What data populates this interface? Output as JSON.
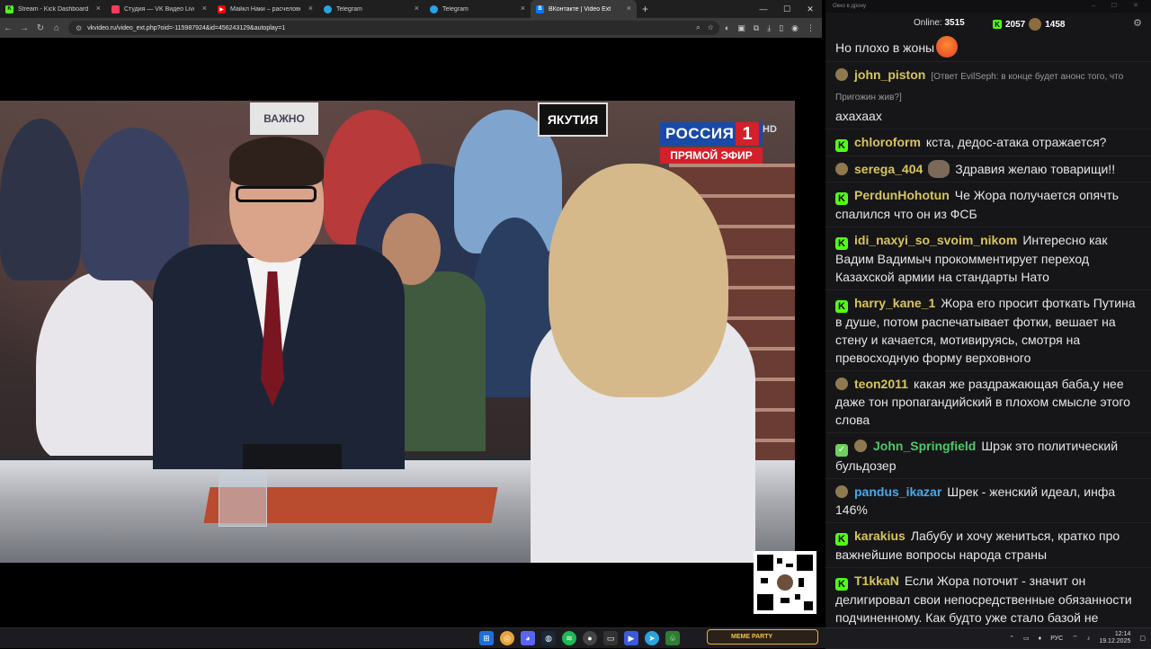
{
  "browser": {
    "tabs": [
      {
        "label": "Stream - Kick Dashboard",
        "icon": "kick-icon",
        "color": "#53fc18",
        "active": false
      },
      {
        "label": "Студия — VK Видео Live",
        "icon": "vk-video-icon",
        "color": "#ff3b5c",
        "active": false
      },
      {
        "label": "Майкл Наки – расчеловечивание",
        "icon": "youtube-icon",
        "color": "#ff0000",
        "active": false
      },
      {
        "label": "Telegram",
        "icon": "telegram-icon",
        "color": "#2aa3e0",
        "active": false
      },
      {
        "label": "Telegram",
        "icon": "telegram-icon",
        "color": "#2aa3e0",
        "active": false
      },
      {
        "label": "ВКонтакте | Video Ext",
        "icon": "vk-icon",
        "color": "#0077ff",
        "active": true
      }
    ],
    "url": "vkvideo.ru/video_ext.php?oid=-115987924&id=456243129&autoplay=1"
  },
  "video": {
    "channel_name": "РОССИЯ",
    "channel_number": "1",
    "channel_hd": "HD",
    "live_label": "ПРЯМОЙ ЭФИР",
    "sign_text": "ЯКУТИЯ",
    "sign2_text": "ВАЖНО"
  },
  "chat": {
    "window_title": "Окно в дрону",
    "online_label": "Online:",
    "online_count": "3515",
    "kick_count": "2057",
    "other_count": "1458",
    "top_message": "Но плохо в жоны",
    "messages": [
      {
        "user": "john_piston",
        "color": "#d8c55a",
        "badge": "p",
        "reply": "[Ответ EvilSeph: в конце будет анонс того, что Пригожин жив?]",
        "text": "ахахаах"
      },
      {
        "user": "chloroform",
        "color": "#d8c55a",
        "badge": "k",
        "text": "кста, дедос-атака отражается?"
      },
      {
        "user": "serega_404",
        "color": "#d8c55a",
        "badge": "p",
        "text": "Здравия желаю товарищи!!",
        "avatar": true
      },
      {
        "user": "PerdunHohotun",
        "color": "#d8c55a",
        "badge": "k",
        "text": "Че Жора получается опячть спалился что он из ФСБ"
      },
      {
        "user": "idi_naxyi_so_svoim_nikom",
        "color": "#d8c55a",
        "badge": "k",
        "text": "Интересно как Вадим Вадимыч прокомментирует переход Казахской армии на стандарты Нато"
      },
      {
        "user": "harry_kane_1",
        "color": "#d8c55a",
        "badge": "k",
        "text": "Жора его просит фоткать Путина в душе, потом распечатывает фотки, вешает на стену и качается, мотивируясь, смотря на превосходную форму верховного"
      },
      {
        "user": "teon2011",
        "color": "#d8c55a",
        "badge": "p",
        "text": "какая же раздражающая баба,у нее даже тон пропагандийский в плохом смысле этого слова"
      },
      {
        "user": "John_Springfield",
        "color": "#4fc869",
        "badge": "cp",
        "text": "Шрэк это политический бульдозер"
      },
      {
        "user": "pandus_ikazar",
        "color": "#4aa8e8",
        "badge": "p",
        "text": "Шрек - женский идеал, инфа 146%"
      },
      {
        "user": "karakius",
        "color": "#d8c55a",
        "badge": "k",
        "text": "Лабубу и хочу жениться, кратко про важнейшие вопросы народа страны"
      },
      {
        "user": "T1kkaN",
        "color": "#d8c55a",
        "badge": "k",
        "text": "Если Жора поточит - значит он делигировал свои непосредственные обязанности подчиненному. Как будто уже стало базой не требующей объяснения."
      }
    ]
  },
  "taskbar": {
    "meme_label": "MEME PARTY",
    "lang": "РУС",
    "time": "12:14",
    "date": "19.12.2025"
  }
}
